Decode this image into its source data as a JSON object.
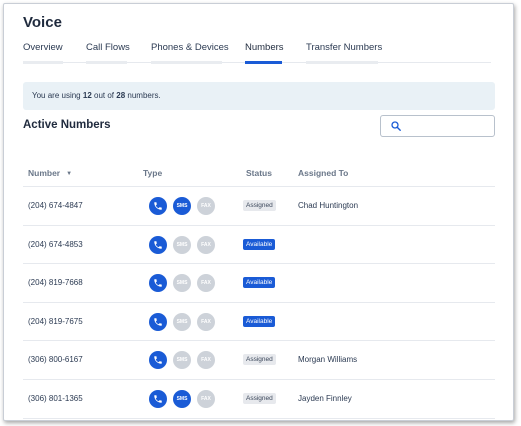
{
  "page": {
    "title": "Voice"
  },
  "tabs": [
    {
      "label": "Overview",
      "active": false
    },
    {
      "label": "Call Flows",
      "active": false
    },
    {
      "label": "Phones & Devices",
      "active": false
    },
    {
      "label": "Numbers",
      "active": true
    },
    {
      "label": "Transfer Numbers",
      "active": false
    }
  ],
  "usage": {
    "prefix": "You are using",
    "used": "12",
    "middle": "out of",
    "total": "28",
    "suffix": "numbers."
  },
  "section": {
    "title": "Active Numbers"
  },
  "search": {
    "placeholder": "",
    "icon": "search-icon"
  },
  "table": {
    "columns": {
      "number": "Number",
      "type": "Type",
      "status": "Status",
      "assigned": "Assigned To"
    },
    "sort_indicator": "▼",
    "type_labels": {
      "sms": "SMS",
      "fax": "FAX"
    },
    "rows": [
      {
        "number": "(204) 674-4847",
        "sms": true,
        "fax": false,
        "status": "Assigned",
        "assigned_to": "Chad Huntington"
      },
      {
        "number": "(204) 674-4853",
        "sms": false,
        "fax": false,
        "status": "Available",
        "assigned_to": ""
      },
      {
        "number": "(204) 819-7668",
        "sms": false,
        "fax": false,
        "status": "Available",
        "assigned_to": ""
      },
      {
        "number": "(204) 819-7675",
        "sms": false,
        "fax": false,
        "status": "Available",
        "assigned_to": ""
      },
      {
        "number": "(306) 800-6167",
        "sms": false,
        "fax": false,
        "status": "Assigned",
        "assigned_to": "Morgan Williams"
      },
      {
        "number": "(306) 801-1365",
        "sms": true,
        "fax": false,
        "status": "Assigned",
        "assigned_to": "Jayden Finnley"
      }
    ]
  },
  "colors": {
    "accent": "#1a5bd6",
    "inactive_icon": "#cdd2d9",
    "banner_bg": "#e9f1f6"
  }
}
